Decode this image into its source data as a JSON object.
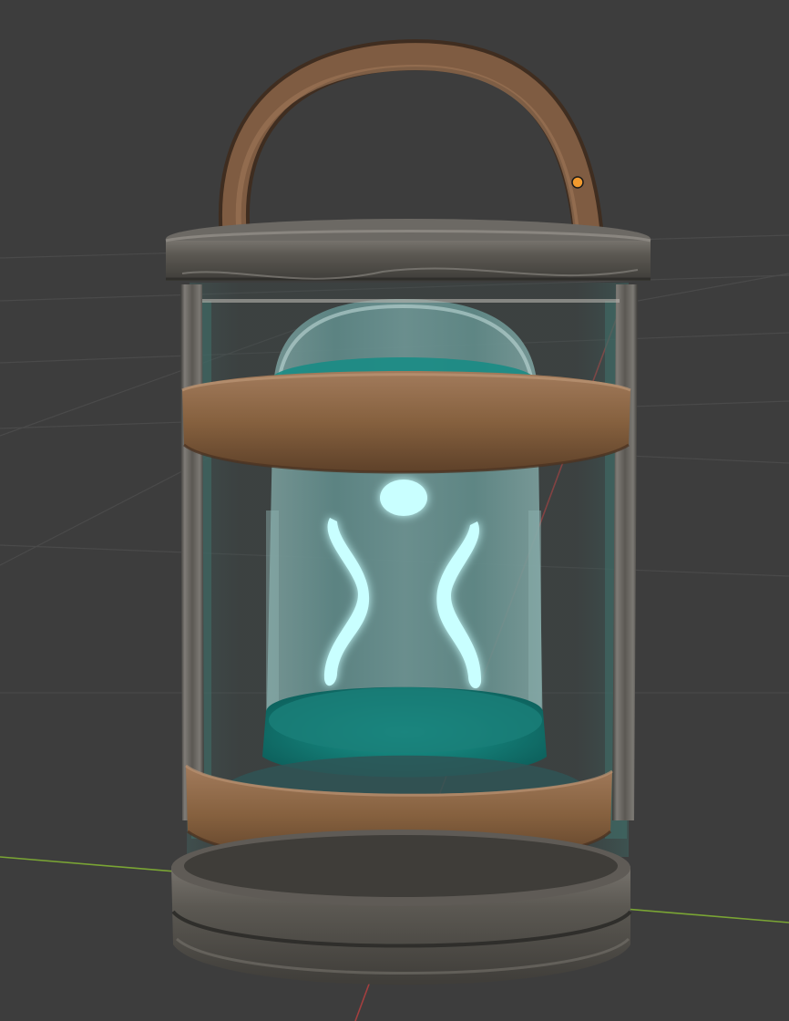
{
  "viewport": {
    "background": "#3d3d3d",
    "grid_color": "#4a4a4a",
    "x_axis_color": "#a33f3f",
    "y_axis_color": "#7aa534",
    "selected_origin_color": "#f29a2e"
  },
  "model": {
    "metal_color": "#5a5753",
    "leather_color": "#8d6548",
    "glass_color": "#6fa9a9",
    "liquid_color": "#18877f",
    "glow_color": "#c9ffff",
    "handle_color": "#7a573f"
  }
}
